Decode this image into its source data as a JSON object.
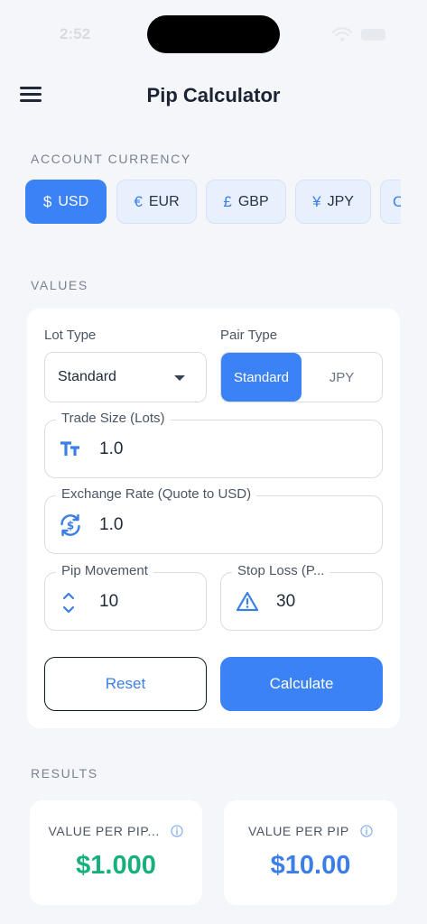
{
  "status_bar": {
    "time": "2:52"
  },
  "header": {
    "title": "Pip Calculator",
    "menu_icon": "menu-icon"
  },
  "account_currency": {
    "label": "ACCOUNT CURRENCY",
    "options": [
      {
        "symbol": "$",
        "code": "USD",
        "selected": true
      },
      {
        "symbol": "€",
        "code": "EUR",
        "selected": false
      },
      {
        "symbol": "£",
        "code": "GBP",
        "selected": false
      },
      {
        "symbol": "¥",
        "code": "JPY",
        "selected": false
      },
      {
        "symbol": "C",
        "code": "",
        "selected": false
      }
    ]
  },
  "values": {
    "label": "VALUES",
    "lot_type": {
      "label": "Lot Type",
      "value": "Standard"
    },
    "pair_type": {
      "label": "Pair Type",
      "options": [
        "Standard",
        "JPY"
      ],
      "selected": "Standard"
    },
    "trade_size": {
      "label": "Trade Size (Lots)",
      "value": "1.0",
      "icon": "text-size-icon"
    },
    "exchange_rate": {
      "label": "Exchange Rate (Quote to USD)",
      "value": "1.0",
      "icon": "currency-exchange-icon"
    },
    "pip_movement": {
      "label": "Pip Movement",
      "value": "10",
      "icon": "up-down-chevron-icon"
    },
    "stop_loss": {
      "label": "Stop Loss (P...",
      "value": "30",
      "icon": "warning-icon"
    },
    "reset_label": "Reset",
    "calculate_label": "Calculate"
  },
  "results": {
    "label": "RESULTS",
    "cards": [
      {
        "label": "VALUE PER PIP...",
        "value": "$1.000",
        "color": "#16b07a"
      },
      {
        "label": "VALUE PER PIP",
        "value": "$10.00",
        "color": "#3b7fe6"
      }
    ]
  },
  "colors": {
    "accent": "#3b82f6",
    "background": "#f4f6f9",
    "success": "#16b07a"
  }
}
